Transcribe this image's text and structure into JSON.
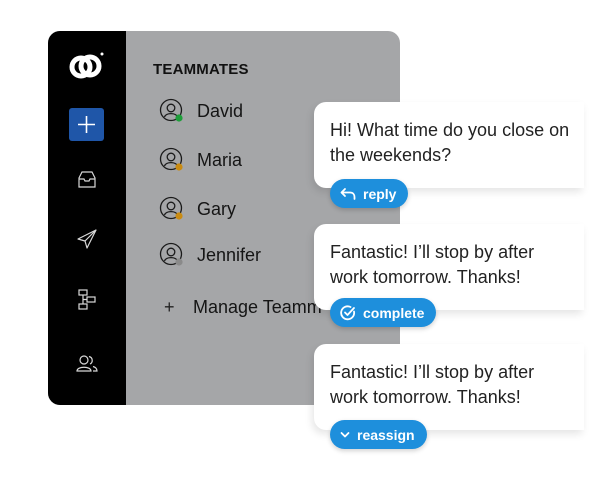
{
  "sidebar": {
    "logo_icon": "linked-circles-logo",
    "add_icon": "plus-icon",
    "nav_icons": [
      "inbox-icon",
      "send-icon",
      "workflow-icon",
      "team-icon"
    ],
    "accent_color": "#1f56a8"
  },
  "teammates_panel": {
    "title": "TEAMMATES",
    "members": [
      {
        "name": "David",
        "status_color": "#1e9e3a"
      },
      {
        "name": "Maria",
        "status_color": "#c98b12"
      },
      {
        "name": "Gary",
        "status_color": "#c98b12"
      },
      {
        "name": "Jennifer",
        "status_color": "#8a8a8a"
      }
    ],
    "manage_plus": "+",
    "manage_label": "Manage Teamm"
  },
  "messages": [
    {
      "text": "Hi! What time do you close on the weekends?",
      "action_label": "reply",
      "action_icon": "reply-arrow-icon"
    },
    {
      "text": "Fantastic! I’ll stop by after work tomorrow. Thanks!",
      "action_label": "complete",
      "action_icon": "check-circle-icon"
    },
    {
      "text": "Fantastic! I’ll stop by after work tomorrow. Thanks!",
      "action_label": "reassign",
      "action_icon": "chevron-down-icon"
    }
  ],
  "colors": {
    "action_blue": "#1e8fdc",
    "panel_gray": "#a5a6a8"
  }
}
